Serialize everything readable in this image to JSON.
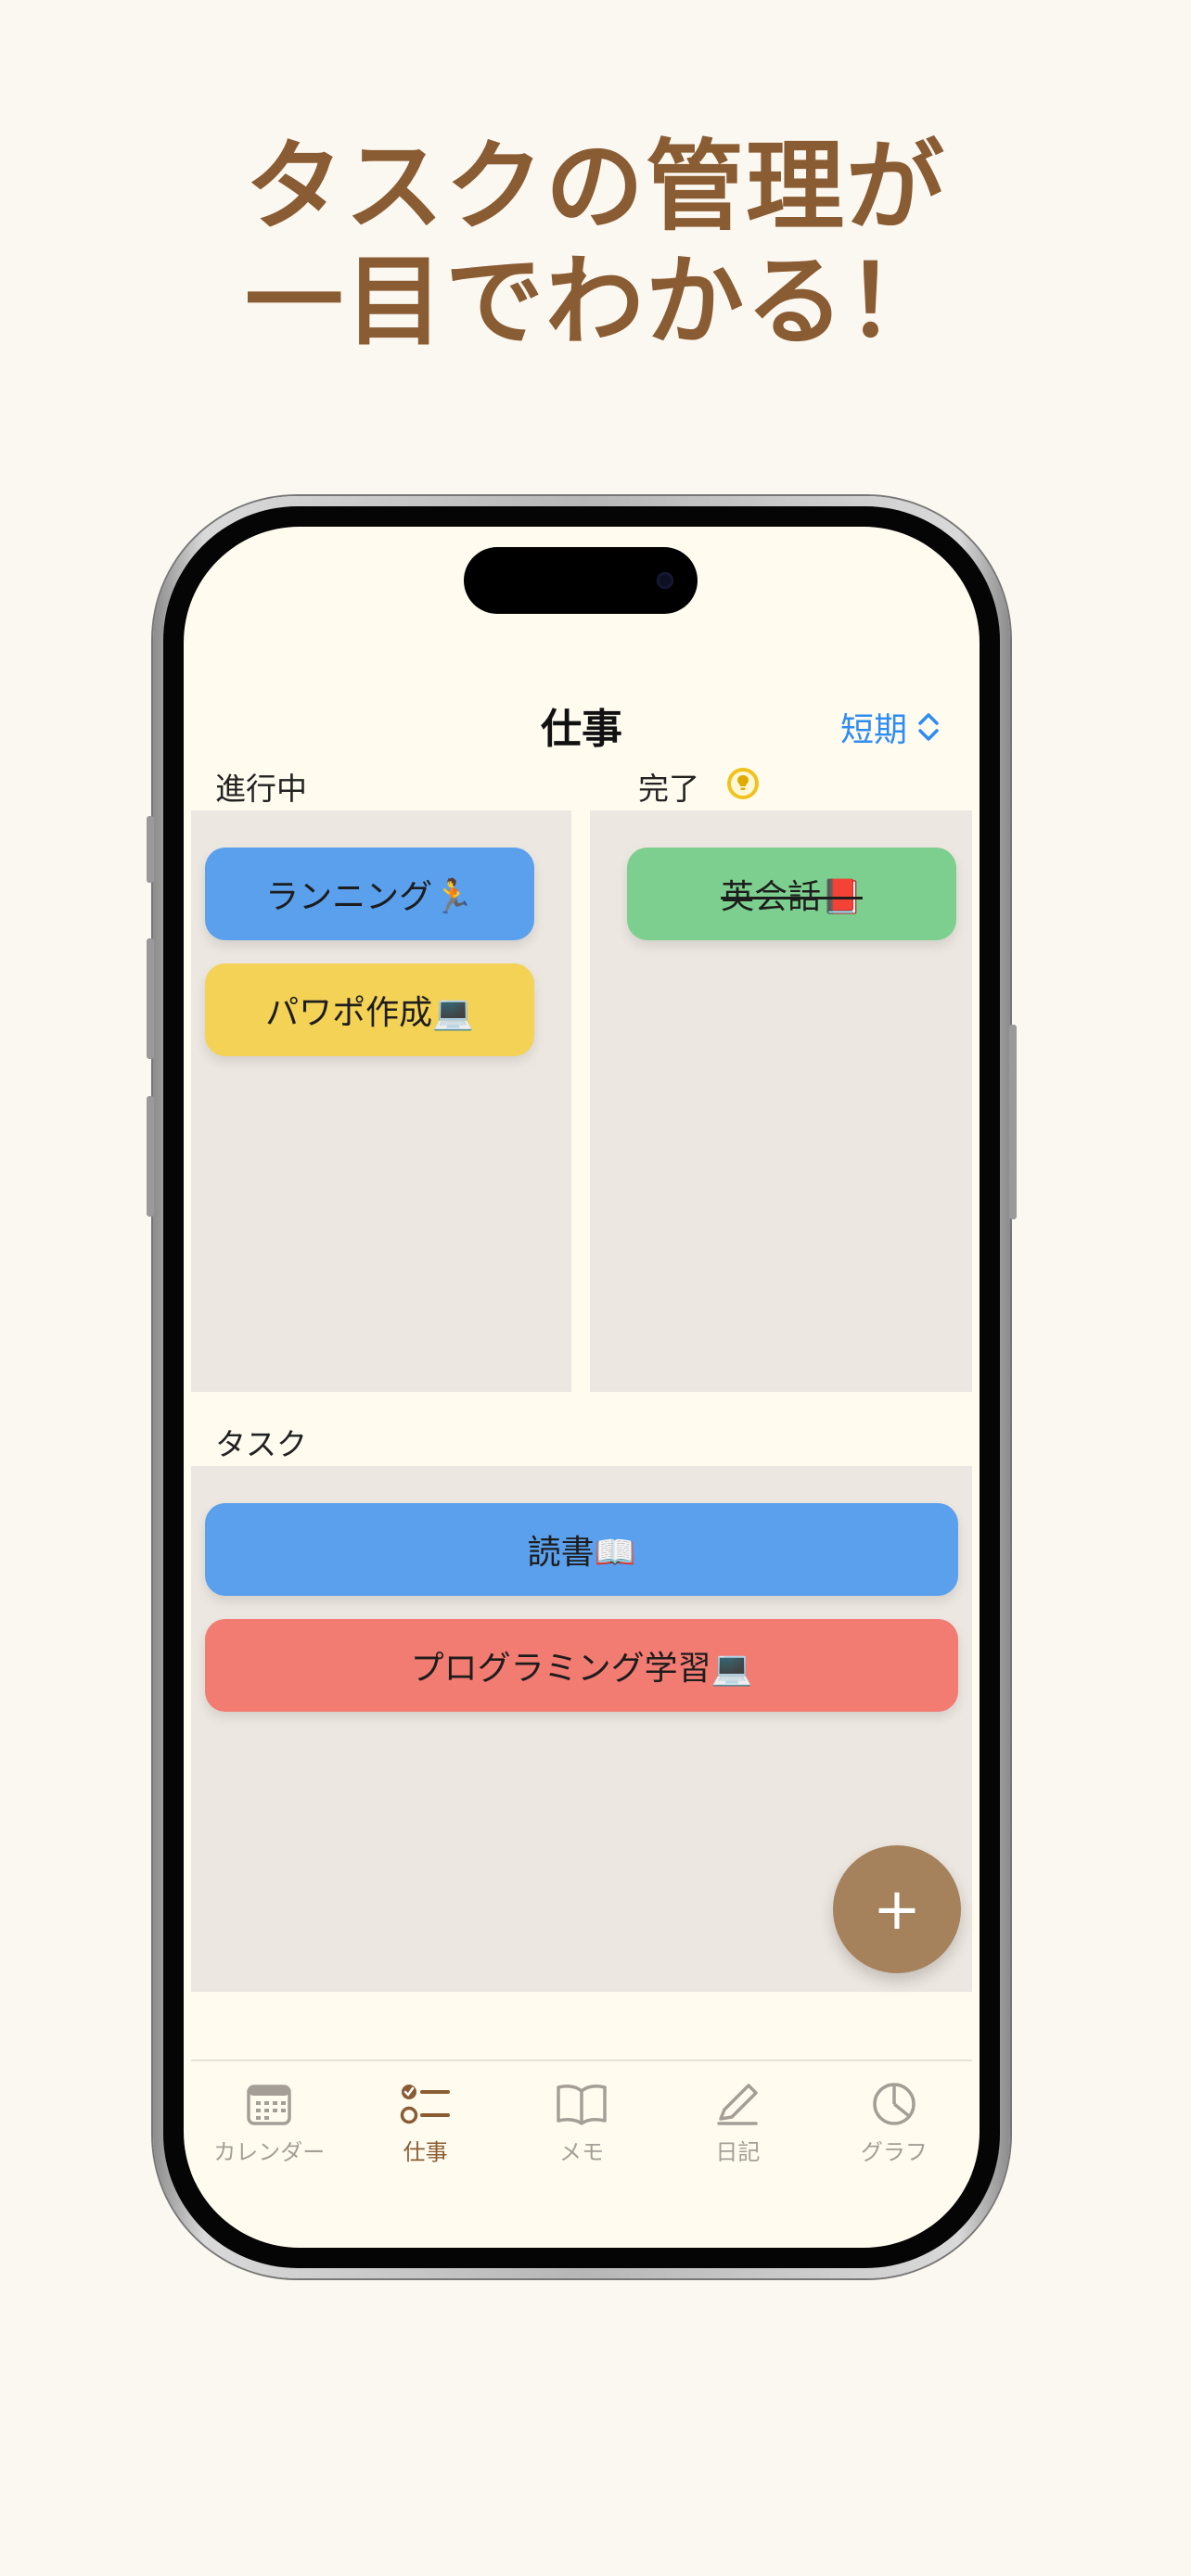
{
  "headline": {
    "line1": "タスクの管理が",
    "line2": "一目でわかる！"
  },
  "nav": {
    "title": "仕事",
    "picker_value": "短期",
    "picker_chevron": "⌃⌄"
  },
  "columns": {
    "in_progress": {
      "label": "進行中",
      "cards": [
        {
          "text": "ランニング🏃",
          "color": "#5aa0ec"
        },
        {
          "text": "パワポ作成💻",
          "color": "#f3d255"
        }
      ]
    },
    "done": {
      "label": "完了",
      "hint_icon": "lightbulb-icon",
      "cards": [
        {
          "text": "英会話📕",
          "color": "#7ccf8e",
          "completed": true
        }
      ]
    }
  },
  "tasks": {
    "label": "タスク",
    "cards": [
      {
        "text": "読書📖",
        "color": "#5aa0ec"
      },
      {
        "text": "プログラミング学習💻",
        "color": "#f27b72"
      }
    ]
  },
  "fab": {
    "icon": "plus-icon",
    "label": "+"
  },
  "tabbar": {
    "items": [
      {
        "label": "カレンダー",
        "icon": "calendar-icon"
      },
      {
        "label": "仕事",
        "icon": "checklist-icon",
        "active": true
      },
      {
        "label": "メモ",
        "icon": "book-icon"
      },
      {
        "label": "日記",
        "icon": "pencil-icon"
      },
      {
        "label": "グラフ",
        "icon": "pie-chart-icon"
      }
    ]
  },
  "colors": {
    "background": "#fbf8f1",
    "headline": "#8a5c33",
    "accent_blue": "#2f8cf0",
    "fab": "#a5825c",
    "panel": "#ede7e1",
    "tab_active": "#8a5c33",
    "tab_inactive": "#a49e97"
  }
}
